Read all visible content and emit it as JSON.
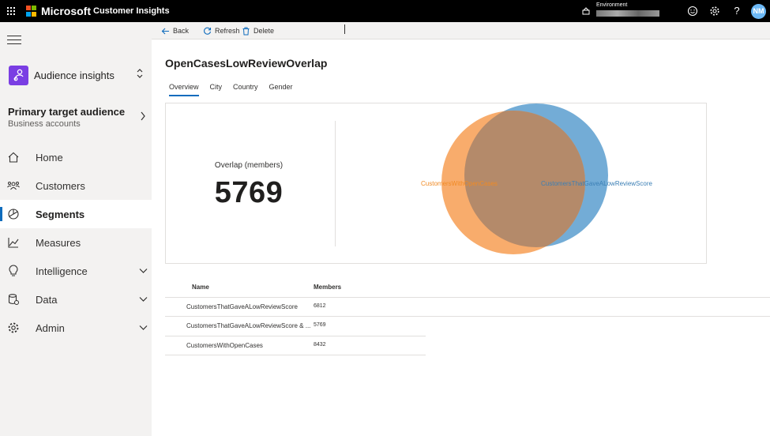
{
  "topbar": {
    "brand": "Microsoft",
    "app_name": "Customer Insights",
    "environment_label": "Environment",
    "help_glyph": "?",
    "avatar_initials": "NM",
    "icons": [
      "waffle-icon",
      "environment-icon",
      "smiley-icon",
      "gear-icon",
      "help-icon"
    ]
  },
  "sidebar": {
    "app_title": "Audience insights",
    "target": {
      "title": "Primary target audience",
      "subtitle": "Business accounts"
    },
    "nav": [
      {
        "label": "Home",
        "icon": "home-icon"
      },
      {
        "label": "Customers",
        "icon": "customers-icon"
      },
      {
        "label": "Segments",
        "icon": "segments-icon",
        "active": true
      },
      {
        "label": "Measures",
        "icon": "measures-icon"
      },
      {
        "label": "Intelligence",
        "icon": "lightbulb-icon",
        "expandable": true
      },
      {
        "label": "Data",
        "icon": "data-icon",
        "expandable": true
      },
      {
        "label": "Admin",
        "icon": "gear-icon",
        "expandable": true
      }
    ]
  },
  "commandbar": {
    "back": "Back",
    "refresh": "Refresh",
    "delete": "Delete"
  },
  "page": {
    "title": "OpenCasesLowReviewOverlap",
    "tabs": [
      "Overview",
      "City",
      "Country",
      "Gender"
    ],
    "active_tab": "Overview"
  },
  "overview": {
    "overlap_label": "Overlap (members)",
    "overlap_value": "5769",
    "venn": {
      "set_a": {
        "name": "CustomersWithOpenCases",
        "color": "#f7a35c"
      },
      "set_b": {
        "name": "CustomersThatGaveALowReviewScore",
        "color": "#5b9ecf"
      },
      "intersection_color": "#b48a6a"
    }
  },
  "table": {
    "columns": [
      "Name",
      "Members"
    ],
    "rows": [
      {
        "name": "CustomersThatGaveALowReviewScore",
        "members": "6812"
      },
      {
        "name": "CustomersThatGaveALowReviewScore & ...",
        "members": "5769"
      },
      {
        "name": "CustomersWithOpenCases",
        "members": "8432"
      }
    ]
  },
  "colors": {
    "accent": "#0f6cbd",
    "app_icon": "#7a3ee3",
    "avatar": "#6cb8f5"
  }
}
